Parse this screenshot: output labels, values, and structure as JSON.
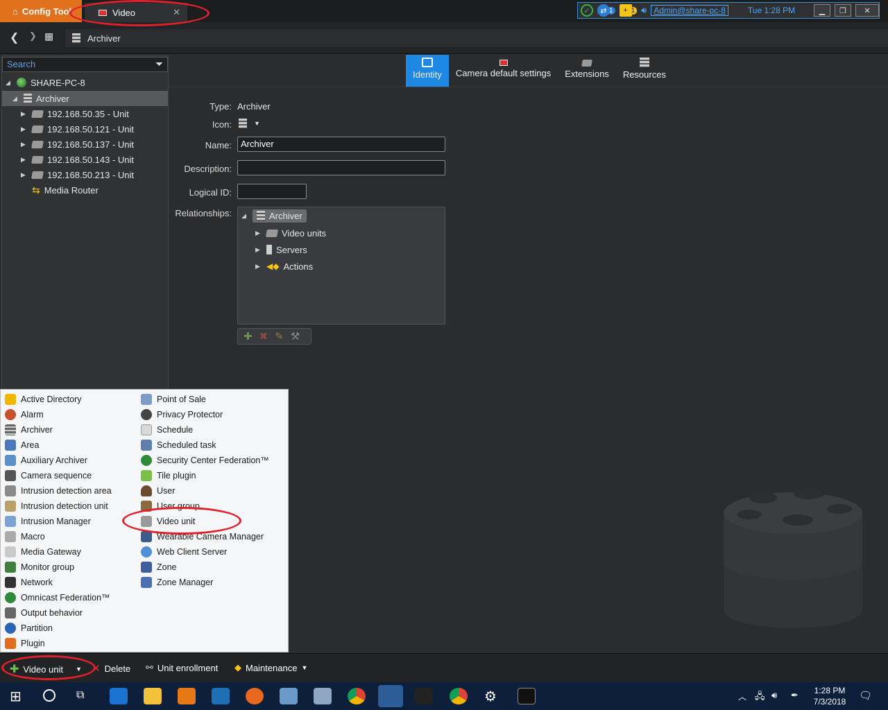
{
  "titlebar": {
    "app_tab": "Config Tool",
    "task_tab": "Video",
    "user": "Admin@share-pc-8",
    "time": "Tue 1:28 PM",
    "tray_badge_1": "1",
    "tray_badge_2": "1"
  },
  "breadcrumb": {
    "label": "Archiver"
  },
  "search": {
    "placeholder": "Search"
  },
  "tree": {
    "root": "SHARE-PC-8",
    "archiver": "Archiver",
    "units": [
      "192.168.50.35 - Unit",
      "192.168.50.121 - Unit",
      "192.168.50.137 - Unit",
      "192.168.50.143 - Unit",
      "192.168.50.213 - Unit"
    ],
    "media_router": "Media Router"
  },
  "tabs": [
    "Identity",
    "Camera default settings",
    "Extensions",
    "Resources"
  ],
  "identity": {
    "type_label": "Type:",
    "type_value": "Archiver",
    "icon_label": "Icon:",
    "name_label": "Name:",
    "name_value": "Archiver",
    "description_label": "Description:",
    "description_value": "",
    "logical_id_label": "Logical ID:",
    "logical_id_value": "",
    "relationships_label": "Relationships:"
  },
  "relationships": {
    "root": "Archiver",
    "children": [
      "Video units",
      "Servers",
      "Actions"
    ]
  },
  "menu": {
    "left": [
      "Active Directory",
      "Alarm",
      "Archiver",
      "Area",
      "Auxiliary Archiver",
      "Camera sequence",
      "Intrusion detection area",
      "Intrusion detection unit",
      "Intrusion Manager",
      "Macro",
      "Media Gateway",
      "Monitor group",
      "Network",
      "Omnicast Federation™",
      "Output behavior",
      "Partition",
      "Plugin"
    ],
    "right": [
      "Point of Sale",
      "Privacy Protector",
      "Schedule",
      "Scheduled task",
      "Security Center Federation™",
      "Tile plugin",
      "User",
      "User group",
      "Video unit",
      "Wearable Camera Manager",
      "Web Client Server",
      "Zone",
      "Zone Manager"
    ]
  },
  "commands": {
    "add": "Video unit",
    "delete": "Delete",
    "enroll": "Unit enrollment",
    "maintenance": "Maintenance"
  },
  "taskbar": {
    "time": "1:28 PM",
    "date": "7/3/2018"
  },
  "colors": {
    "accent": "#1e88e5",
    "config_tab": "#e2711d",
    "annotation": "#e0202a"
  }
}
